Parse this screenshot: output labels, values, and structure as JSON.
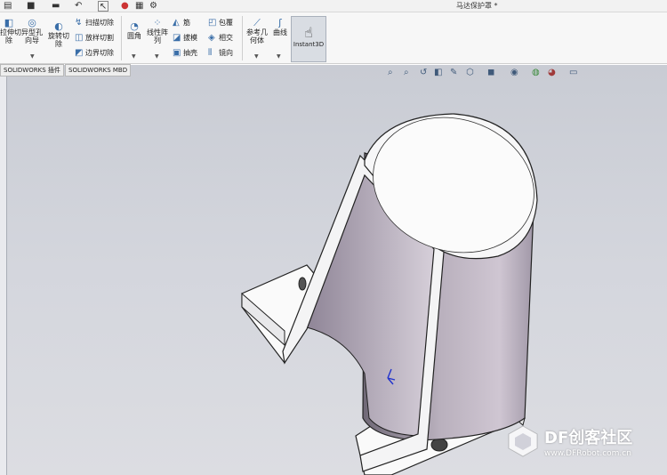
{
  "window": {
    "title": "马达保护罩 *"
  },
  "quick_access": {
    "items": [
      {
        "name": "new-document-icon",
        "glyph": "▤"
      },
      {
        "name": "save-icon",
        "glyph": "■"
      },
      {
        "name": "print-icon",
        "glyph": "▬"
      },
      {
        "name": "undo-icon",
        "glyph": "↶"
      },
      {
        "name": "select-arrow-icon",
        "glyph": "↖"
      },
      {
        "name": "traffic-light-icon",
        "glyph": "●"
      },
      {
        "name": "file-properties-icon",
        "glyph": "▦"
      },
      {
        "name": "options-gear-icon",
        "glyph": "⚙"
      }
    ]
  },
  "ribbon": {
    "large_buttons": [
      {
        "id": "extruded-cut",
        "label": "拉伸切\n除",
        "glyph": "◧"
      },
      {
        "id": "hole-wizard",
        "label": "异型孔\n向导",
        "glyph": "◎"
      },
      {
        "id": "revolved-cut",
        "label": "旋转切\n除",
        "glyph": "◐"
      },
      {
        "id": "fillet",
        "label": "圆角",
        "glyph": "◔"
      },
      {
        "id": "linear-pattern",
        "label": "线性阵\n列",
        "glyph": "⁘"
      },
      {
        "id": "reference-geometry",
        "label": "参考几\n何体",
        "glyph": "⟋"
      },
      {
        "id": "curves",
        "label": "曲线",
        "glyph": "ʃ"
      }
    ],
    "small_buttons": [
      {
        "id": "swept-cut",
        "label": "扫描切除",
        "glyph": "↯"
      },
      {
        "id": "lofted-cut",
        "label": "放样切割",
        "glyph": "◫"
      },
      {
        "id": "boundary-cut",
        "label": "边界切除",
        "glyph": "◩"
      },
      {
        "id": "rib",
        "label": "筋",
        "glyph": "◭"
      },
      {
        "id": "draft",
        "label": "拔模",
        "glyph": "◪"
      },
      {
        "id": "shell",
        "label": "抽壳",
        "glyph": "▣"
      },
      {
        "id": "wrap",
        "label": "包覆",
        "glyph": "◰"
      },
      {
        "id": "intersect",
        "label": "相交",
        "glyph": "◈"
      },
      {
        "id": "mirror",
        "label": "镜向",
        "glyph": "⫴"
      }
    ],
    "instant3d": {
      "label": "Instant3D",
      "glyph": "☝"
    }
  },
  "tabs": [
    {
      "label": "SOLIDWORKS 插件"
    },
    {
      "label": "SOLIDWORKS MBD"
    }
  ],
  "heads_up_toolbar": [
    {
      "name": "zoom-to-fit-icon",
      "glyph": "⌕"
    },
    {
      "name": "zoom-to-area-icon",
      "glyph": "⌕"
    },
    {
      "name": "previous-view-icon",
      "glyph": "↺"
    },
    {
      "name": "section-view-icon",
      "glyph": "◧"
    },
    {
      "name": "dynamic-annotation-icon",
      "glyph": "✎"
    },
    {
      "name": "view-orientation-icon",
      "glyph": "⬡"
    },
    {
      "name": "display-style-icon",
      "glyph": "◼"
    },
    {
      "name": "hide-show-items-icon",
      "glyph": "◉"
    },
    {
      "name": "edit-appearance-icon",
      "glyph": "◍"
    },
    {
      "name": "apply-scene-icon",
      "glyph": "◕"
    },
    {
      "name": "view-settings-icon",
      "glyph": "▭"
    }
  ],
  "watermark": {
    "brand": "DF创客社区",
    "url": "www.DFRobot.com.cn"
  }
}
